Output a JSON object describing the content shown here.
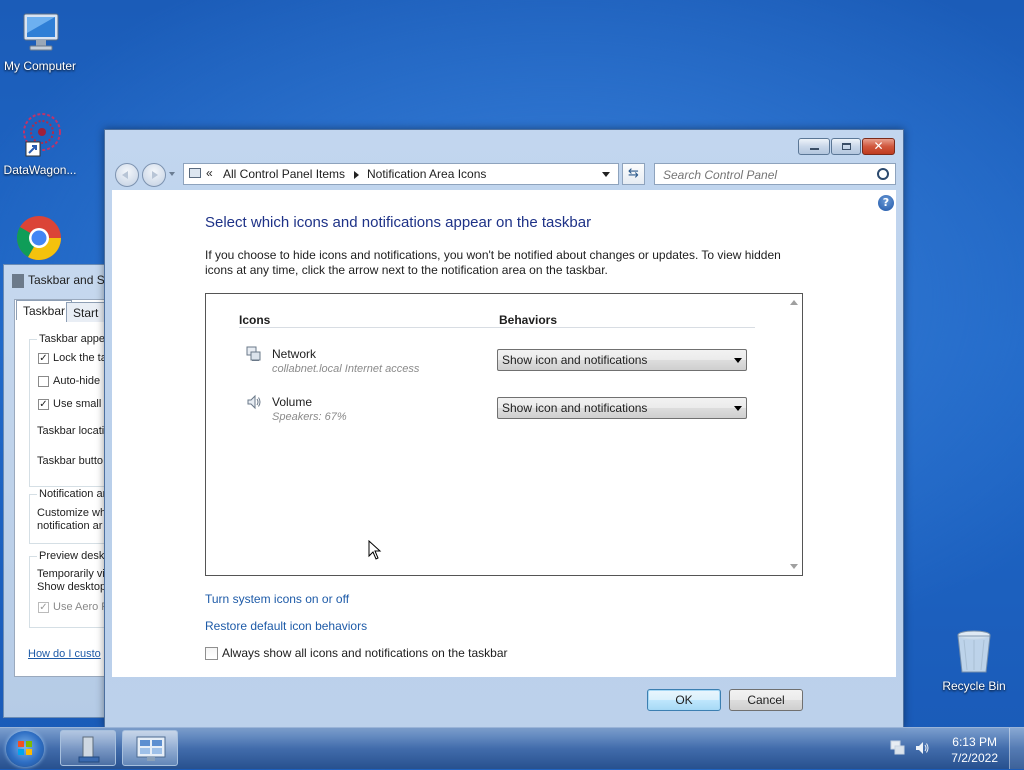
{
  "desktop": {
    "icons": [
      {
        "label": "My Computer",
        "icon": "computer-icon"
      },
      {
        "label": "DataWagon...",
        "icon": "datawagon-icon"
      },
      {
        "label": "",
        "icon": "chrome-icon"
      },
      {
        "label": "Recycle Bin",
        "icon": "recycle-bin-icon"
      }
    ]
  },
  "background_window": {
    "title": "Taskbar and S",
    "tabs": [
      "Taskbar",
      "Start M"
    ],
    "lines": {
      "taskbar_appearance": "Taskbar appea",
      "lock": "Lock the ta",
      "autohide": "Auto-hide",
      "small_icons": "Use small i",
      "location": "Taskbar locati",
      "buttons": "Taskbar butto",
      "notification_group": "Notification ar",
      "customize1": "Customize wh",
      "customize2": "notification ar",
      "preview_group": "Preview deskt",
      "temporarily": "Temporarily vi",
      "show_desktop": "Show desktop",
      "aero": "Use Aero P",
      "howdoi": "How do I custo"
    }
  },
  "window": {
    "address": {
      "segments": [
        "All Control Panel Items",
        "Notification Area Icons"
      ]
    },
    "search": {
      "placeholder": "Search Control Panel"
    },
    "heading": "Select which icons and notifications appear on the taskbar",
    "description": "If you choose to hide icons and notifications, you won't be notified about changes or updates. To view hidden icons at any time, click the arrow next to the notification area on the taskbar.",
    "table": {
      "headers": {
        "icons": "Icons",
        "behaviors": "Behaviors"
      },
      "rows": [
        {
          "name": "Network",
          "detail": "collabnet.local Internet access",
          "behavior": "Show icon and notifications",
          "icon": "network-icon"
        },
        {
          "name": "Volume",
          "detail": "Speakers: 67%",
          "behavior": "Show icon and notifications",
          "icon": "speaker-icon"
        }
      ]
    },
    "links": {
      "system_icons": "Turn system icons on or off",
      "restore": "Restore default icon behaviors"
    },
    "always_show": {
      "label": "Always show all icons and notifications on the taskbar",
      "checked": false
    },
    "buttons": {
      "ok": "OK",
      "cancel": "Cancel"
    }
  },
  "taskbar": {
    "time": "6:13 PM",
    "date": "7/2/2022"
  },
  "colors": {
    "heading": "#1e3287",
    "link": "#1e5ba8",
    "desktop": "#1f68c8"
  }
}
